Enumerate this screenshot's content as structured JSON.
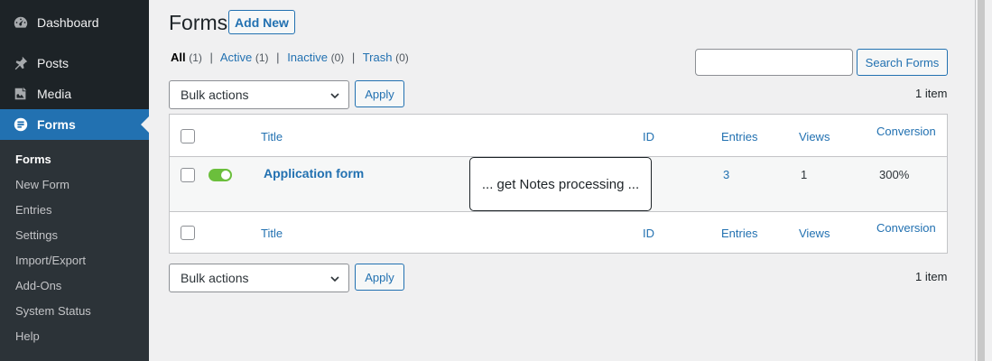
{
  "sidebar": {
    "dashboard": "Dashboard",
    "posts": "Posts",
    "media": "Media",
    "forms": "Forms",
    "submenu": [
      "Forms",
      "New Form",
      "Entries",
      "Settings",
      "Import/Export",
      "Add-Ons",
      "System Status",
      "Help"
    ]
  },
  "header": {
    "title": "Forms",
    "add_new": "Add New"
  },
  "filters": {
    "all": {
      "label": "All",
      "count": "(1)"
    },
    "active": {
      "label": "Active",
      "count": "(1)"
    },
    "inactive": {
      "label": "Inactive",
      "count": "(0)"
    },
    "trash": {
      "label": "Trash",
      "count": "(0)"
    },
    "separator": "|"
  },
  "search": {
    "button": "Search Forms",
    "value": ""
  },
  "bulk": {
    "top": "Bulk actions",
    "bottom": "Bulk actions",
    "apply": "Apply",
    "items": "1 item"
  },
  "table": {
    "columns": {
      "title": "Title",
      "id": "ID",
      "entries": "Entries",
      "views": "Views",
      "conversion": "Conversion"
    },
    "rows": [
      {
        "title": "Application form",
        "id": "",
        "entries": "3",
        "views": "1",
        "conversion": "300%",
        "active": true
      }
    ]
  },
  "notice": "... get Notes processing ...",
  "colors": {
    "accent": "#2271b1",
    "sidebar": "#1d2327",
    "toggle_on": "#6bbf3c"
  }
}
